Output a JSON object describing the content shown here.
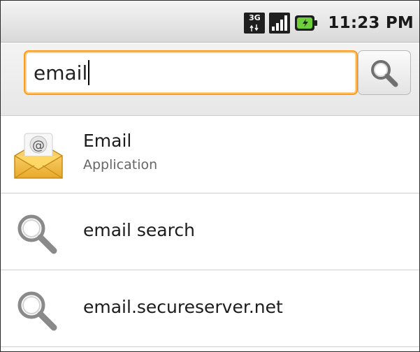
{
  "status_bar": {
    "network_type": "3G",
    "time": "11:23 PM",
    "icons": [
      "3g-data-icon",
      "signal-strength-icon",
      "battery-charging-icon"
    ]
  },
  "search": {
    "query": "email",
    "accent_color": "#ff9c1a"
  },
  "results": [
    {
      "title": "Email",
      "subtitle": "Application",
      "icon": "email-app-icon"
    },
    {
      "title": "email search",
      "icon": "search-icon"
    },
    {
      "title": "email.secureserver.net",
      "icon": "search-icon"
    }
  ]
}
